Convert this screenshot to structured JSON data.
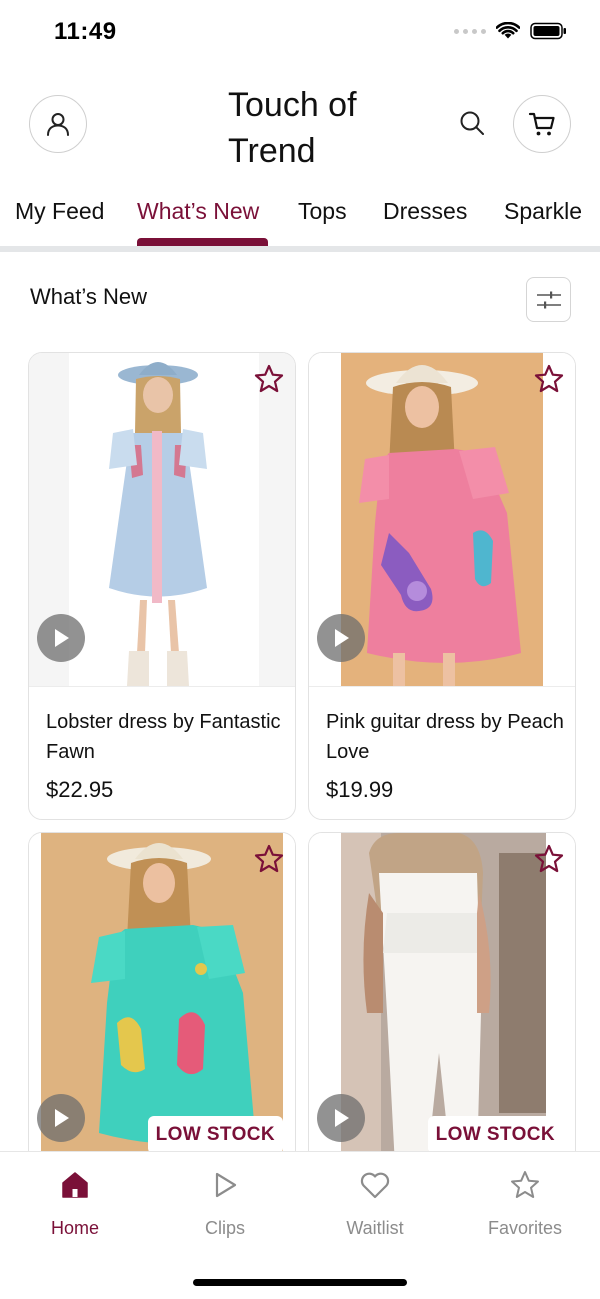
{
  "status": {
    "time": "11:49"
  },
  "header": {
    "title": "Touch of Trend"
  },
  "tabs": [
    {
      "label": "My Feed"
    },
    {
      "label": "What’s New"
    },
    {
      "label": "Tops"
    },
    {
      "label": "Dresses"
    },
    {
      "label": "Sparkle"
    }
  ],
  "active_tab": "What’s New",
  "section": {
    "title": "What’s New"
  },
  "products": [
    {
      "name": "Lobster dress by Fantastic Fawn",
      "price": "$22.95"
    },
    {
      "name": "Pink guitar dress by Peach Love",
      "price": "$19.99"
    },
    {
      "badge": "LOW STOCK"
    },
    {
      "badge": "LOW STOCK"
    }
  ],
  "bottom_nav": [
    {
      "label": "Home",
      "icon": "home-icon"
    },
    {
      "label": "Clips",
      "icon": "play-icon"
    },
    {
      "label": "Waitlist",
      "icon": "heart-icon"
    },
    {
      "label": "Favorites",
      "icon": "star-icon"
    }
  ],
  "active_nav": "Home",
  "colors": {
    "accent": "#7a1038",
    "divider": "#e4e6e8"
  }
}
